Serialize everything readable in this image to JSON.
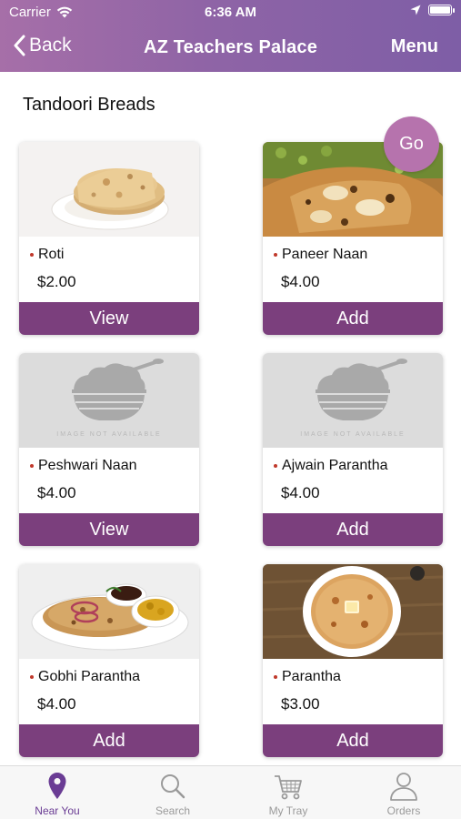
{
  "status_bar": {
    "carrier": "Carrier",
    "time": "6:36 AM"
  },
  "nav": {
    "back_label": "Back",
    "title": "AZ Teachers Palace",
    "menu_label": "Menu"
  },
  "section_title": "Tandoori Breads",
  "go_label": "Go",
  "items": [
    {
      "name": "Roti",
      "price": "$2.00",
      "button": "View",
      "image": "roti"
    },
    {
      "name": "Paneer Naan",
      "price": "$4.00",
      "button": "Add",
      "image": "paneer-naan"
    },
    {
      "name": "Peshwari Naan",
      "price": "$4.00",
      "button": "View",
      "image": "placeholder"
    },
    {
      "name": "Ajwain Parantha",
      "price": "$4.00",
      "button": "Add",
      "image": "placeholder"
    },
    {
      "name": "Gobhi Parantha",
      "price": "$4.00",
      "button": "Add",
      "image": "gobhi-parantha"
    },
    {
      "name": "Parantha",
      "price": "$3.00",
      "button": "Add",
      "image": "parantha"
    }
  ],
  "placeholder_text": "IMAGE NOT AVAILABLE",
  "tabs": [
    {
      "label": "Near You",
      "icon": "location-pin-icon",
      "active": true
    },
    {
      "label": "Search",
      "icon": "search-icon",
      "active": false
    },
    {
      "label": "My Tray",
      "icon": "cart-icon",
      "active": false
    },
    {
      "label": "Orders",
      "icon": "user-icon",
      "active": false
    }
  ],
  "colors": {
    "header_start": "#a66fa8",
    "header_end": "#7e5ea6",
    "button": "#7b3f7d",
    "go_button": "#b673ad",
    "active_tab": "#6a3c94"
  }
}
